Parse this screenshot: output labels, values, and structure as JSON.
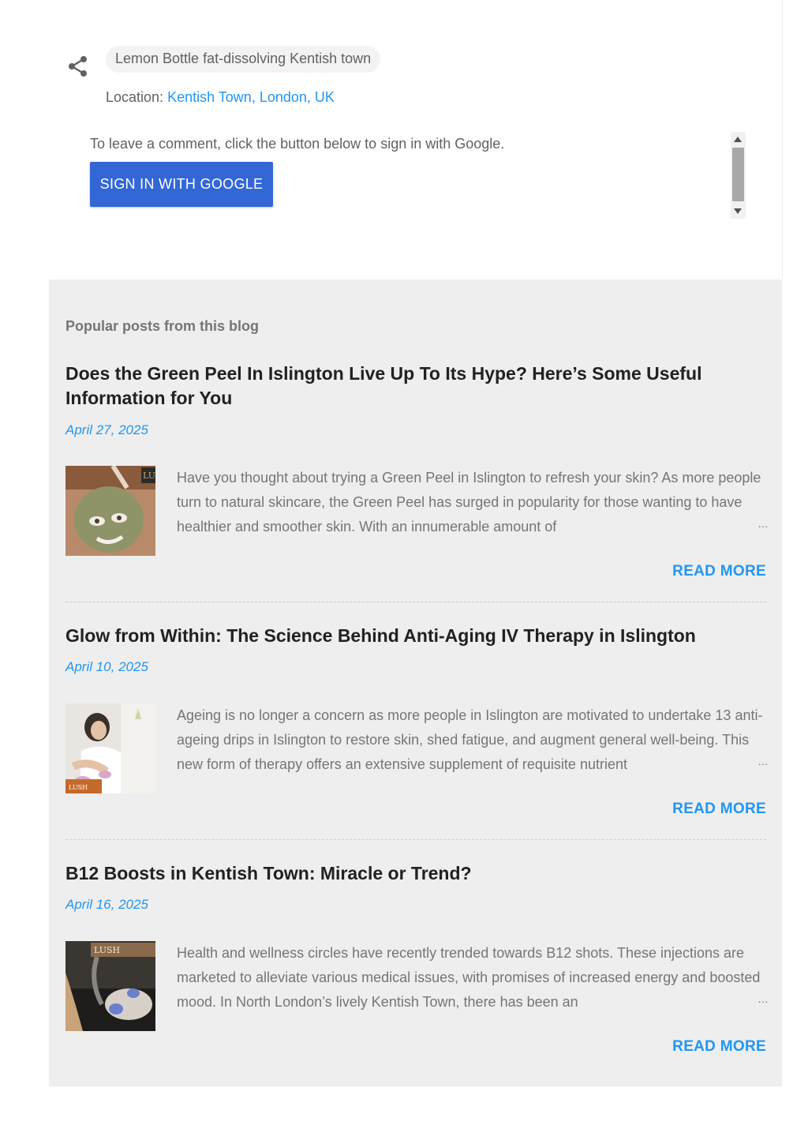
{
  "post_meta": {
    "labels": [
      "Lemon Bottle fat-dissolving Kentish town"
    ],
    "location_prefix": "Location:",
    "location_value": "Kentish Town, London, UK"
  },
  "comments": {
    "prompt": "To leave a comment, click the button below to sign in with Google.",
    "signin_label": "SIGN IN WITH GOOGLE"
  },
  "popular": {
    "heading": "Popular posts from this blog",
    "read_more_label": "READ MORE",
    "ellipsis": "…",
    "posts": [
      {
        "title": "Does the Green Peel In Islington Live Up To Its Hype? Here’s Some Useful Information for You",
        "date": "April 27, 2025",
        "snippet": "  Have you thought about trying a Green Peel in Islington to refresh your skin? As more people turn to natural skincare, the Green Peel has surged in popularity for those wanting to have healthier and smoother skin. With an innumerable amount of",
        "thumb_text": "LU"
      },
      {
        "title": "Glow from Within: The Science Behind Anti-Aging IV Therapy in Islington",
        "date": "April 10, 2025",
        "snippet": "  Ageing is no longer a concern as more people in Islington are motivated to undertake 13 anti-ageing drips in Islington to restore skin, shed fatigue, and augment general well-being. This new form of therapy offers an extensive supplement of requisite nutrient",
        "thumb_text": "LUSH"
      },
      {
        "title": "B12 Boosts in Kentish Town: Miracle or Trend?",
        "date": "April 16, 2025",
        "snippet": "  Health and wellness circles have recently trended towards B12 shots. These injections are marketed to alleviate various medical issues, with promises of increased energy and boosted mood. In North London’s lively Kentish Town, there has been an",
        "thumb_text": "LUSH"
      }
    ]
  },
  "colors": {
    "accent": "#2196f3",
    "button": "#3367d6",
    "panel_bg": "#eeeeee"
  }
}
